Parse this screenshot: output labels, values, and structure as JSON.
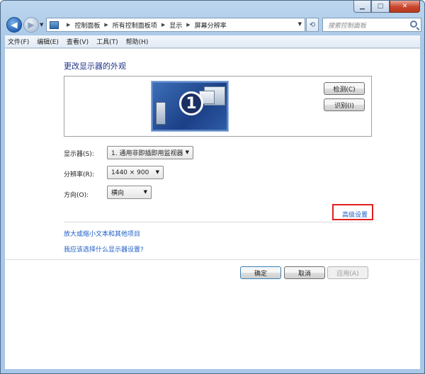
{
  "nav": {
    "address_crumbs": [
      "控制面板",
      "所有控制面板项",
      "显示",
      "屏幕分辨率"
    ],
    "search_placeholder": "搜索控制面板"
  },
  "menubar": {
    "items": [
      "文件(F)",
      "编辑(E)",
      "查看(V)",
      "工具(T)",
      "帮助(H)"
    ]
  },
  "main": {
    "title": "更改显示器的外观",
    "monitor_number": "1",
    "detect_label": "检测(C)",
    "identify_label": "识别(I)",
    "display_label": "显示器(S):",
    "display_value": "1. 通用非即插即用监视器",
    "resolution_label": "分辨率(R):",
    "resolution_value": "1440 × 900",
    "orientation_label": "方向(O):",
    "orientation_value": "横向",
    "advanced_link": "高级设置",
    "link_text_size": "放大或缩小文本和其他项目",
    "link_which_settings": "我应该选择什么显示器设置?"
  },
  "footer": {
    "ok_label": "确定",
    "cancel_label": "取消",
    "apply_label": "应用(A)"
  },
  "colors": {
    "link": "#1c5ec7",
    "title": "#1e3287",
    "highlight_box": "#e02020"
  }
}
